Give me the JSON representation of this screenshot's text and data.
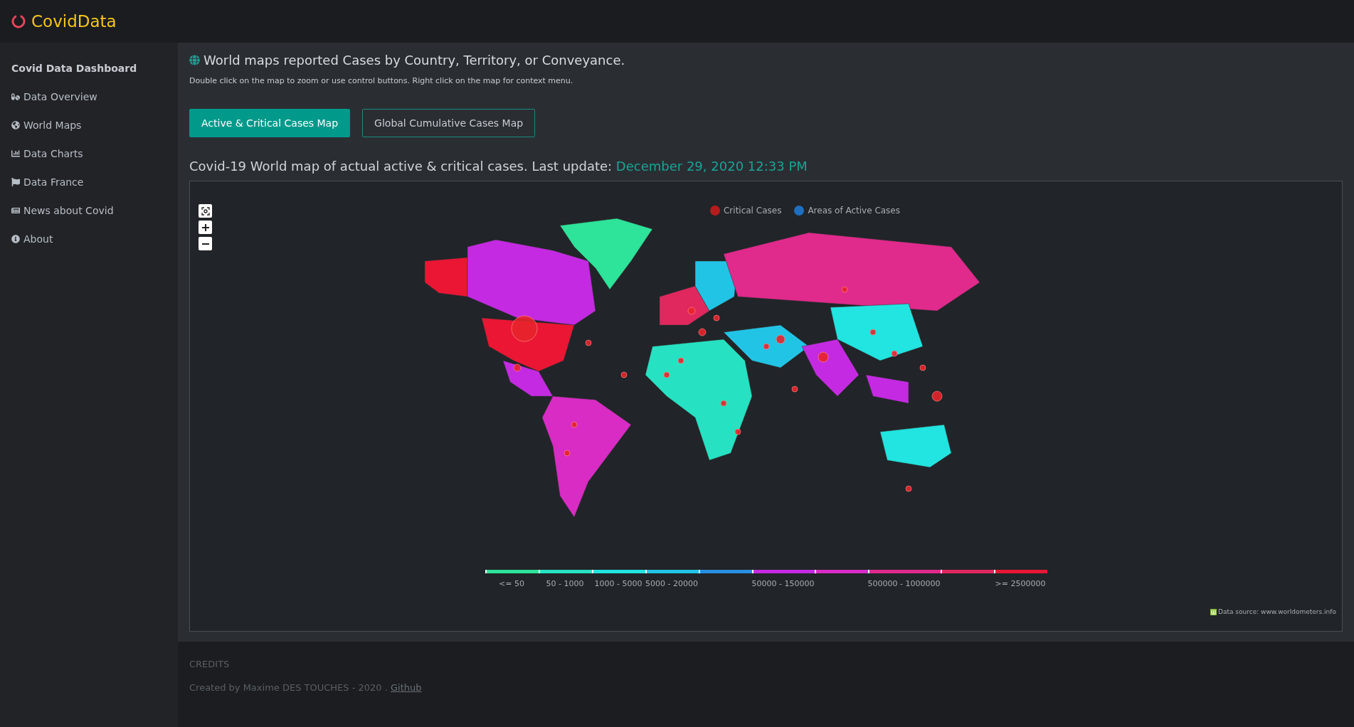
{
  "brand": {
    "name": "CovidData"
  },
  "sidebar": {
    "heading": "Covid Data Dashboard",
    "items": [
      {
        "label": "Data Overview",
        "kind": "pills"
      },
      {
        "label": "World Maps",
        "kind": "globe"
      },
      {
        "label": "Data Charts",
        "kind": "chart"
      },
      {
        "label": "Data France",
        "kind": "flag"
      },
      {
        "label": "News about Covid",
        "kind": "news"
      },
      {
        "label": "About",
        "kind": "info"
      }
    ]
  },
  "page": {
    "title": "World maps reported Cases by Country, Territory, or Conveyance.",
    "hint": "Double click on the map to zoom or use control buttons. Right click on the map for context menu.",
    "tabs": [
      {
        "label": "Active & Critical Cases Map",
        "selected": true
      },
      {
        "label": "Global Cumulative Cases Map",
        "selected": false
      }
    ],
    "subtitle": "Covid-19 World map of actual active & critical cases. Last update:",
    "updated": "December 29, 2020 12:33 PM"
  },
  "map": {
    "legend": [
      {
        "label": "Critical Cases",
        "color": "#b71c1c"
      },
      {
        "label": "Areas of Active Cases",
        "color": "#1e6fc0"
      }
    ],
    "scale": [
      {
        "color": "#2ee39a",
        "label": "<= 50"
      },
      {
        "color": "#26e2c2",
        "label": "50 - 1000"
      },
      {
        "color": "#22e4e0",
        "label": "1000 - 5000"
      },
      {
        "color": "#22c4e6",
        "label": "5000 - 20000"
      },
      {
        "color": "#2a8ee0"
      },
      {
        "color": "#c42ae2",
        "label": "50000 - 150000"
      },
      {
        "color": "#d82cc4"
      },
      {
        "color": "#e02a8c",
        "label": "500000 - 1000000"
      },
      {
        "color": "#e0285e"
      },
      {
        "color": "#ea1634",
        "label": ">= 2500000"
      }
    ],
    "source": "Data source: www.worldometers.info"
  },
  "footer": {
    "heading": "CREDITS",
    "text": "Created by Maxime DES TOUCHES - 2020 .",
    "link": "Github"
  }
}
